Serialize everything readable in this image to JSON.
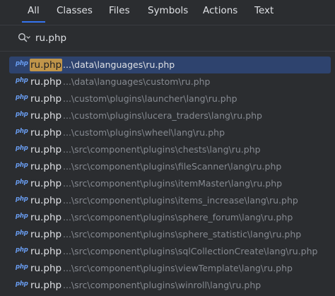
{
  "tabs": [
    {
      "label": "All",
      "active": true
    },
    {
      "label": "Classes",
      "active": false
    },
    {
      "label": "Files",
      "active": false
    },
    {
      "label": "Symbols",
      "active": false
    },
    {
      "label": "Actions",
      "active": false
    },
    {
      "label": "Text",
      "active": false
    }
  ],
  "search": {
    "icon": "search-filter-icon",
    "query": "ru.php"
  },
  "colors": {
    "background": "#2b2d30",
    "selection": "#2e436e",
    "match_highlight": "#c0954a",
    "tab_underline": "#3574f0",
    "php_icon": "#6a9ff5",
    "path_text": "#868a91"
  },
  "results": [
    {
      "icon": "php",
      "name": "ru.php",
      "path": "...\\data\\languages\\ru.php",
      "selected": true
    },
    {
      "icon": "php",
      "name": "ru.php",
      "path": "...\\data\\languages\\custom\\ru.php"
    },
    {
      "icon": "php",
      "name": "ru.php",
      "path": "...\\custom\\plugins\\launcher\\lang\\ru.php"
    },
    {
      "icon": "php",
      "name": "ru.php",
      "path": "...\\custom\\plugins\\lucera_traders\\lang\\ru.php"
    },
    {
      "icon": "php",
      "name": "ru.php",
      "path": "...\\custom\\plugins\\wheel\\lang\\ru.php"
    },
    {
      "icon": "php",
      "name": "ru.php",
      "path": "...\\src\\component\\plugins\\chests\\lang\\ru.php"
    },
    {
      "icon": "php",
      "name": "ru.php",
      "path": "...\\src\\component\\plugins\\fileScanner\\lang\\ru.php"
    },
    {
      "icon": "php",
      "name": "ru.php",
      "path": "...\\src\\component\\plugins\\itemMaster\\lang\\ru.php"
    },
    {
      "icon": "php",
      "name": "ru.php",
      "path": "...\\src\\component\\plugins\\items_increase\\lang\\ru.php"
    },
    {
      "icon": "php",
      "name": "ru.php",
      "path": "...\\src\\component\\plugins\\sphere_forum\\lang\\ru.php"
    },
    {
      "icon": "php",
      "name": "ru.php",
      "path": "...\\src\\component\\plugins\\sphere_statistic\\lang\\ru.php"
    },
    {
      "icon": "php",
      "name": "ru.php",
      "path": "...\\src\\component\\plugins\\sqlCollectionCreate\\lang\\ru.php"
    },
    {
      "icon": "php",
      "name": "ru.php",
      "path": "...\\src\\component\\plugins\\viewTemplate\\lang\\ru.php"
    },
    {
      "icon": "php",
      "name": "ru.php",
      "path": "...\\src\\component\\plugins\\winroll\\lang\\ru.php"
    }
  ]
}
